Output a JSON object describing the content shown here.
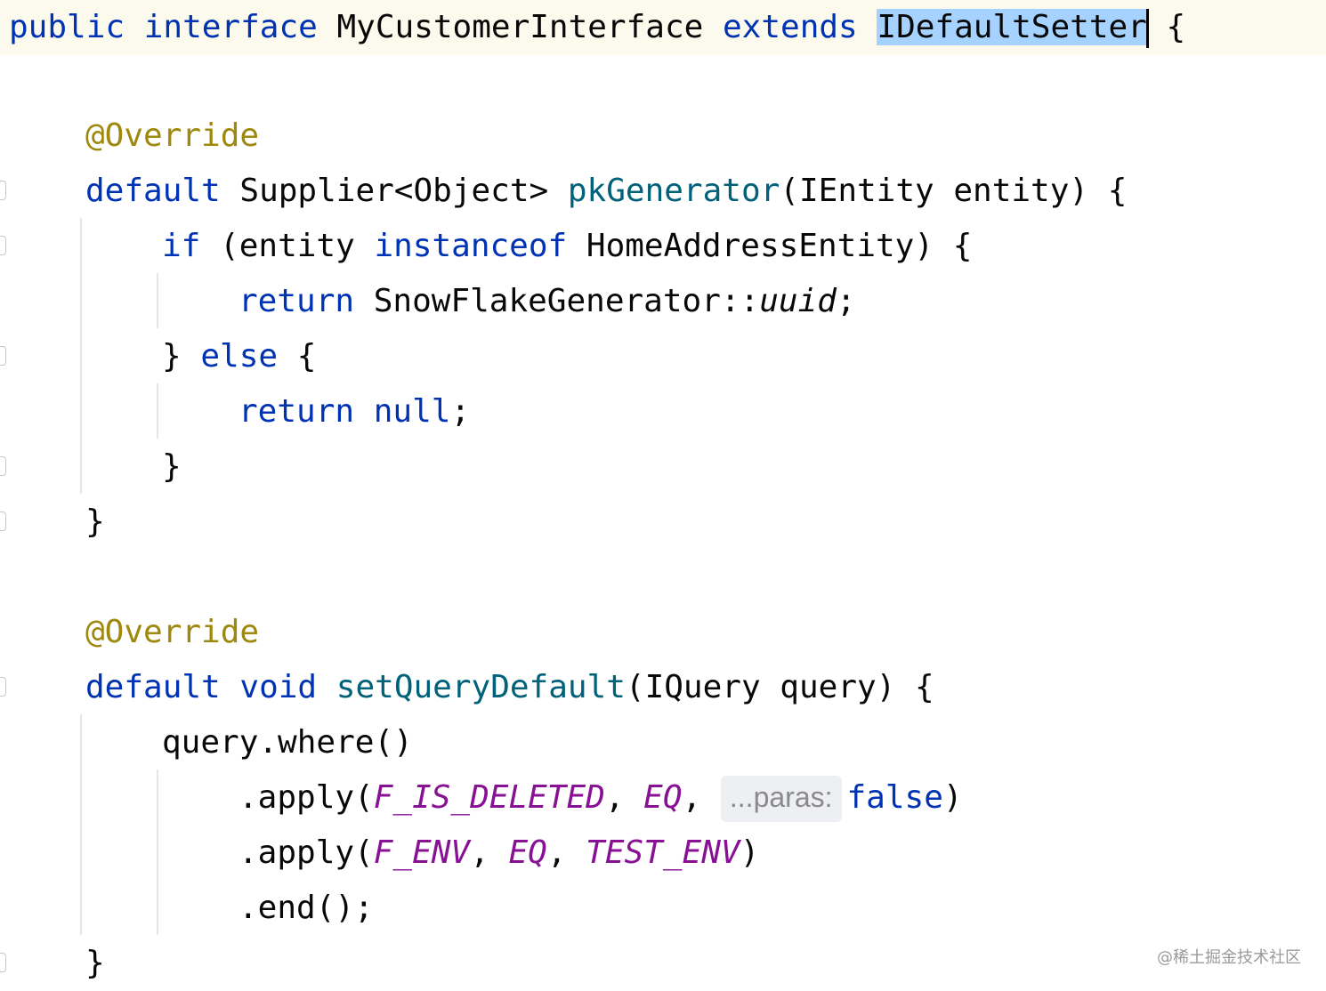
{
  "code": {
    "l1": {
      "public": "public",
      "interface": "interface",
      "name": "MyCustomerInterface",
      "extends": "extends",
      "parent": "IDefaultSetter",
      "brace": "{"
    },
    "ann1": "@Override",
    "m1": {
      "default": "default",
      "type": "Supplier<Object>",
      "name": "pkGenerator",
      "params": "(IEntity entity) {"
    },
    "if_line": {
      "kw": "if",
      "open": "(entity",
      "instanceof": "instanceof",
      "rest": "HomeAddressEntity) {"
    },
    "ret1": {
      "kw": "return",
      "ref": "SnowFlakeGenerator::",
      "method": "uuid",
      "semi": ";"
    },
    "else_line": {
      "close": "}",
      "kw": "else",
      "brace": "{"
    },
    "ret2": {
      "kw": "return",
      "null": "null",
      "semi": ";"
    },
    "close_if": "}",
    "close_m1": "}",
    "ann2": "@Override",
    "m2": {
      "default": "default",
      "void": "void",
      "name": "setQueryDefault",
      "params": "(IQuery query) {"
    },
    "where": "query.where()",
    "apply1": {
      "prefix": ".apply(",
      "c1": "F_IS_DELETED",
      "sep1": ", ",
      "c2": "EQ",
      "sep2": ", ",
      "hint": "...paras:",
      "val": "false",
      "close": ")"
    },
    "apply2": {
      "prefix": ".apply(",
      "c1": "F_ENV",
      "sep1": ", ",
      "c2": "EQ",
      "sep2": ", ",
      "c3": "TEST_ENV",
      "close": ")"
    },
    "end": ".end();",
    "close_m2": "}"
  },
  "watermark": "@稀土掘金技术社区",
  "colors": {
    "keyword": "#0033b3",
    "annotation": "#9e880d",
    "method": "#00627a",
    "constant": "#871094",
    "selection": "#a6d2ff",
    "caret_line": "#fcfaed"
  }
}
